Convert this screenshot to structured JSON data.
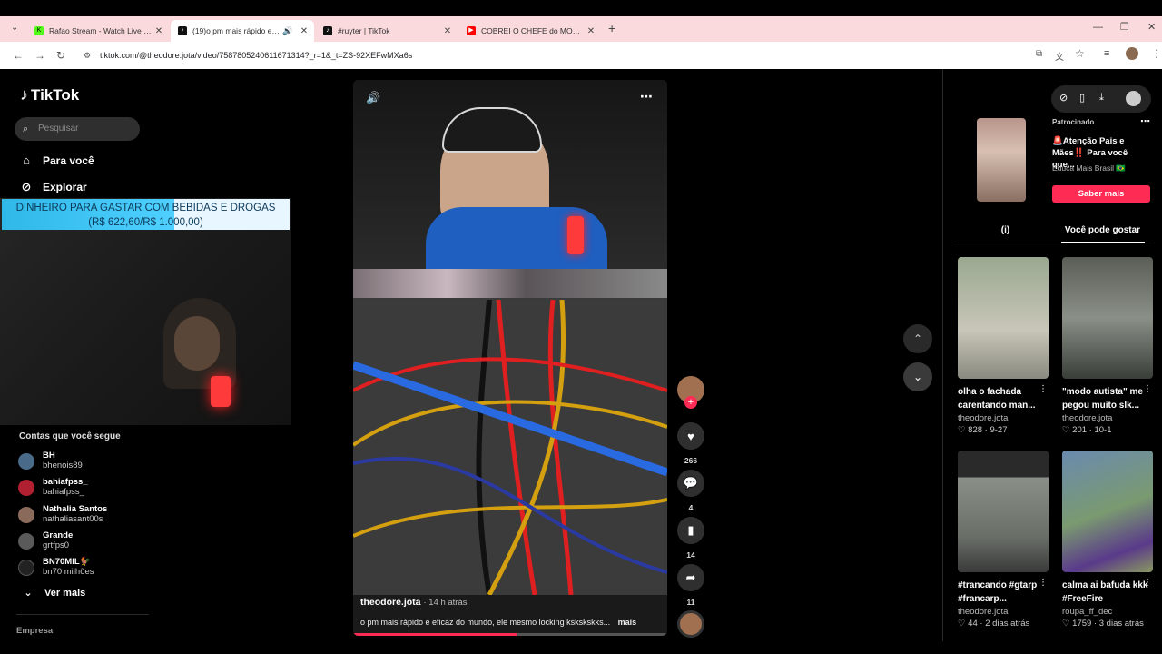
{
  "browser": {
    "tabs": [
      {
        "title": "Rafao Stream - Watch Live on Ki",
        "icon": "kick-icon",
        "color": "#53fc18"
      },
      {
        "title": "(19)o pm mais rápido e efic",
        "icon": "tiktok-icon",
        "color": "#000000"
      },
      {
        "title": "#ruyter | TikTok",
        "icon": "tiktok-icon",
        "color": "#000000"
      },
      {
        "title": "COBREI O CHEFE do MORRO",
        "icon": "youtube-icon",
        "color": "#ff0000"
      }
    ],
    "url": "tiktok.com/@theodore.jota/video/7587805240611671314?_r=1&_t=ZS-92XEFwMXa6s"
  },
  "sidebar": {
    "logo": "TikTok",
    "search_placeholder": "Pesquisar",
    "nav": [
      {
        "label": "Para você",
        "icon": "home-icon"
      },
      {
        "label": "Explorar",
        "icon": "compass-icon"
      }
    ],
    "stream_banner_line1": "DINHEIRO PARA GASTAR COM BEBIDAS E DROGAS",
    "stream_banner_line2": "(R$ 622,60/R$ 1.000,00)",
    "following_title": "Contas que você segue",
    "following": [
      {
        "name": "BH",
        "user": "bhenois89",
        "color": "#4a6a8a"
      },
      {
        "name": "bahiafpss_",
        "user": "bahiafpss_",
        "color": "#b02030"
      },
      {
        "name": "Nathalia Santos",
        "user": "nathaliasant00s",
        "color": "#8a6a5a"
      },
      {
        "name": "Grande",
        "user": "grtfps0",
        "color": "#5a5a5a"
      },
      {
        "name": "BN70MIL🐓",
        "user": "bn70 milhões",
        "color": "#222222"
      }
    ],
    "see_more": "Ver mais",
    "footer": "Empresa"
  },
  "video": {
    "author": "theodore.jota",
    "time": "· 14 h atrás",
    "description": "o pm mais rápido e eficaz do mundo, ele mesmo locking kskskskks...",
    "more": "mais",
    "progress": 0.52
  },
  "actions": {
    "likes": "266",
    "comments": "4",
    "saves": "14",
    "shares": "11"
  },
  "ad": {
    "label": "Patrocinado",
    "text": "🚨Atenção Pais e Mães‼️ Para você que...",
    "advertiser": "Educa Mais Brasil 🇧🇷",
    "button": "Saber mais"
  },
  "right_tabs": [
    {
      "label": "(i)"
    },
    {
      "label": "Você pode gostar"
    }
  ],
  "recommendations": [
    {
      "title": "olha o fachada carentando man...",
      "author": "theodore.jota",
      "likes": "828",
      "date": "9-27",
      "colors": [
        "#6a7a5a",
        "#b0b6a0"
      ]
    },
    {
      "title": "\"modo autista\" me pegou muito slk...",
      "author": "theodore.jota",
      "likes": "201",
      "date": "10-1",
      "colors": [
        "#4a5048",
        "#8a8f88"
      ]
    },
    {
      "title": "#trancando #gtarp #francarp...",
      "author": "theodore.jota",
      "likes": "44",
      "date": "2 dias atrás",
      "colors": [
        "#2a2a2a",
        "#7a8a7a"
      ]
    },
    {
      "title": "calma ai bafuda kkk #FreeFire",
      "author": "roupa_ff_dec",
      "likes": "1759",
      "date": "3 dias atrás",
      "colors": [
        "#3a5a8a",
        "#8aa070"
      ]
    }
  ]
}
